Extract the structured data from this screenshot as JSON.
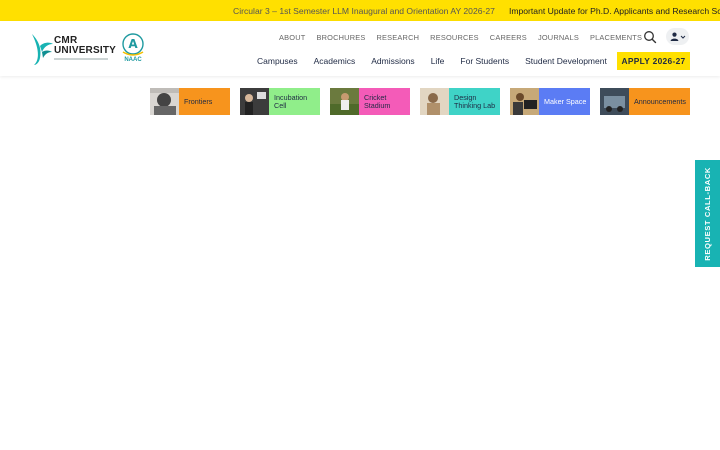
{
  "ticker": {
    "items": [
      "Circular 3 – 1st Semester LLM Inaugural and Orientation AY 2026-27",
      "Important Update for Ph.D. Applicants and Research Sc"
    ]
  },
  "logo": {
    "name_line1": "CMR",
    "name_line2": "UNIVERSITY",
    "naac_grade": "A",
    "naac_label": "NAAC"
  },
  "top_nav": [
    "ABOUT",
    "BROCHURES",
    "RESEARCH",
    "RESOURCES",
    "CAREERS",
    "JOURNALS",
    "PLACEMENTS"
  ],
  "main_nav": [
    "Campuses",
    "Academics",
    "Admissions",
    "Life",
    "For Students",
    "Student Development"
  ],
  "apply_label": "APPLY 2026-27",
  "icons": {
    "search": "search-icon",
    "user": "user-icon",
    "chevron": "chevron-down-icon"
  },
  "tiles": [
    {
      "label": "Frontiers",
      "color": "#f7941d"
    },
    {
      "label": "Incubation Cell",
      "color": "#90ee8a"
    },
    {
      "label": "Cricket Stadium",
      "color": "#f45bb8"
    },
    {
      "label": "Design Thinking Lab",
      "color": "#3fd3c7"
    },
    {
      "label": "Maker Space",
      "color": "#5b7cf4"
    },
    {
      "label": "Announcements",
      "color": "#f7941d"
    }
  ],
  "callback_label": "REQUEST CALL-BACK",
  "colors": {
    "brand_yellow": "#ffe000",
    "brand_teal": "#18b3b3",
    "nav_text": "#1f2a44"
  }
}
